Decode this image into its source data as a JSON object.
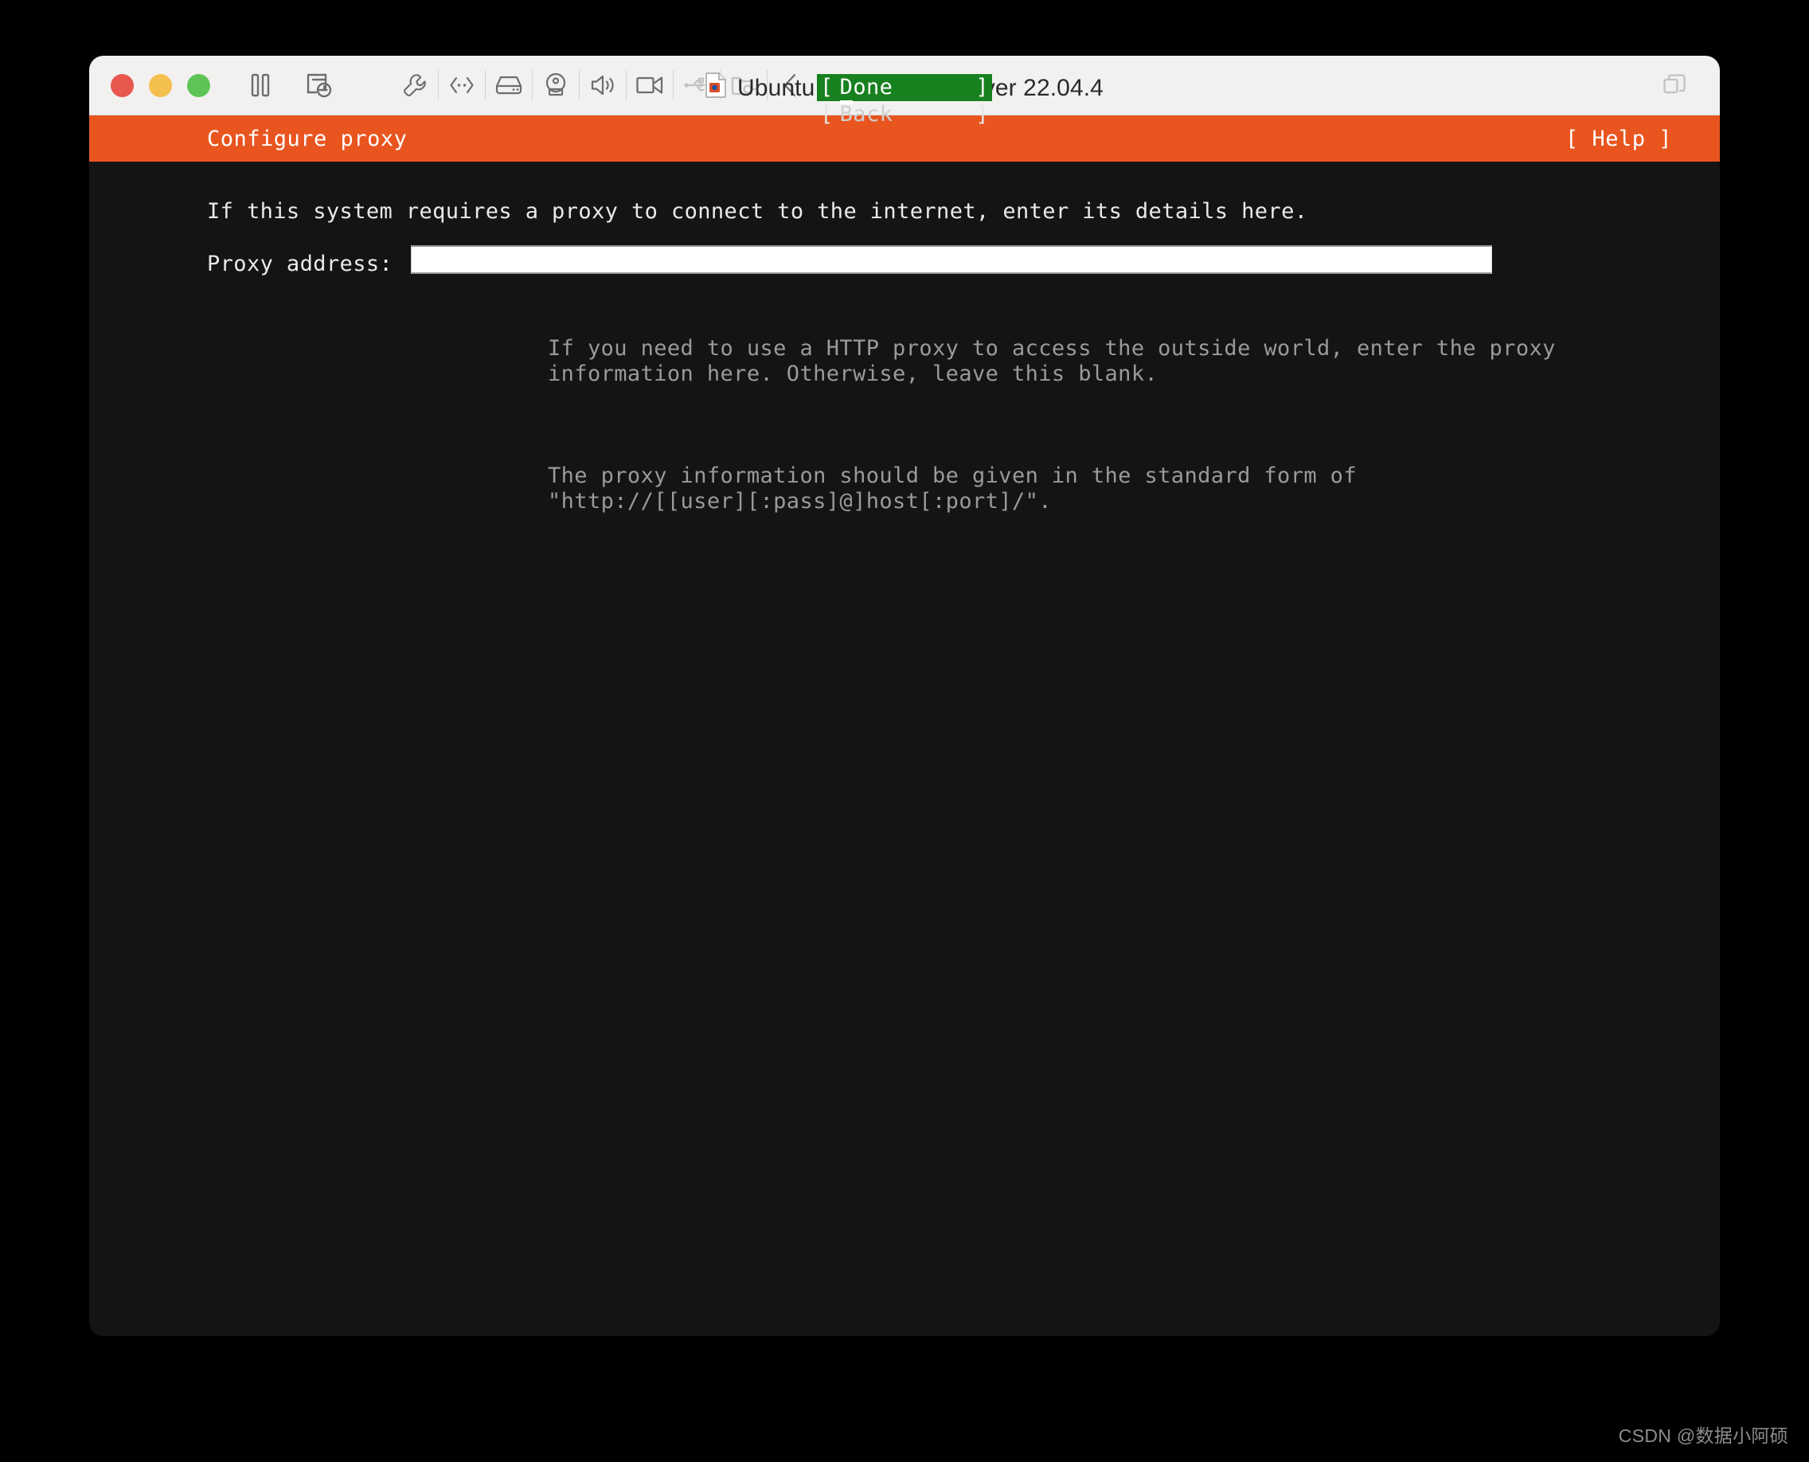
{
  "window": {
    "title": "Ubuntu 64 位 ARM Server 22.04.4",
    "title_icon": "document-icon",
    "traffic_lights": [
      {
        "name": "close",
        "color": "#e8584f"
      },
      {
        "name": "minimize",
        "color": "#f3bf4d"
      },
      {
        "name": "maximize",
        "color": "#5dc455"
      }
    ],
    "toolbar": {
      "left_icons": [
        {
          "name": "pause-icon",
          "enabled": true
        },
        {
          "name": "snapshot-icon",
          "enabled": true
        }
      ],
      "device_icons": [
        {
          "name": "wrench-icon",
          "enabled": true
        },
        {
          "name": "network-icon",
          "enabled": true
        },
        {
          "name": "harddisk-icon",
          "enabled": true
        },
        {
          "name": "webcam-icon",
          "enabled": true
        },
        {
          "name": "speaker-icon",
          "enabled": true
        },
        {
          "name": "videocamera-icon",
          "enabled": true
        },
        {
          "name": "usb-icon",
          "enabled": false
        },
        {
          "name": "shared-folder-icon",
          "enabled": false
        },
        {
          "name": "back-chevron-icon",
          "enabled": true
        }
      ],
      "right_icons": [
        {
          "name": "fullscreen-icon",
          "enabled": true
        }
      ]
    }
  },
  "installer": {
    "header": {
      "screen_title": "Configure proxy",
      "help_label": "[ Help ]"
    },
    "intro": "If this system requires a proxy to connect to the internet, enter its details here.",
    "proxy_field": {
      "label": "Proxy address:",
      "value": "",
      "placeholder": ""
    },
    "hints": [
      "If you need to use a HTTP proxy to access the outside world, enter the proxy\ninformation here. Otherwise, leave this blank.",
      "The proxy information should be given in the standard form of\n\"http://[[user][:pass]@]host[:port]/\"."
    ],
    "buttons": [
      {
        "label": "Done",
        "bracket_left": "[",
        "bracket_right": "]",
        "selected": true
      },
      {
        "label": "Back",
        "bracket_left": "[",
        "bracket_right": "]",
        "selected": false
      }
    ]
  },
  "watermark": "CSDN @数据小阿硕",
  "colors": {
    "header_orange": "#e8551f",
    "selected_green": "#17801f",
    "terminal_bg": "#141414",
    "titlebar_bg": "#f2f1f0",
    "dim_text": "#9a9a9a"
  }
}
